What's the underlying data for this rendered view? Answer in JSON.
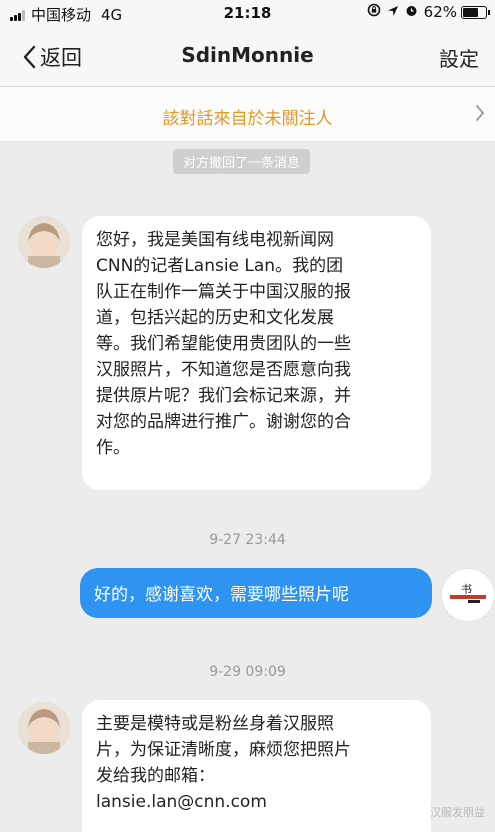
{
  "status_bar": {
    "carrier": "中国移动",
    "network": "4G",
    "time": "21:18",
    "battery": "62%",
    "battery_level": 0.62
  },
  "nav": {
    "back_label": "返回",
    "title": "SdinMonnie",
    "settings_label": "設定"
  },
  "notice": {
    "text": "該對話來自於未關注人"
  },
  "messages": {
    "recalled_notice": "对方撤回了一条消息",
    "msg1": "您好，我是美国有线电视新闻网\nCNN的记者Lansie Lan。我的团\n队正在制作一篇关于中国汉服的报\n道，包括兴起的历史和文化发展\n等。我们希望能使用贵团队的一些\n汉服照片，不知道您是否愿意向我\n提供原片呢？我们会标记来源，并\n对您的品牌进行推广。谢谢您的合\n作。",
    "time1": "9-27 23:44",
    "reply1": "好的，感谢喜欢，需要哪些照片呢",
    "time2": "9-29 09:09",
    "msg2": "主要是模特或是粉丝身着汉服照\n片，为保证清晰度，麻烦您把照片\n发给我的邮箱：\nlansie.lan@cnn.com"
  },
  "watermark": "汉服发朋益",
  "colors": {
    "accent_blue": "#2e93f1",
    "notice_orange": "#e39a2a"
  }
}
